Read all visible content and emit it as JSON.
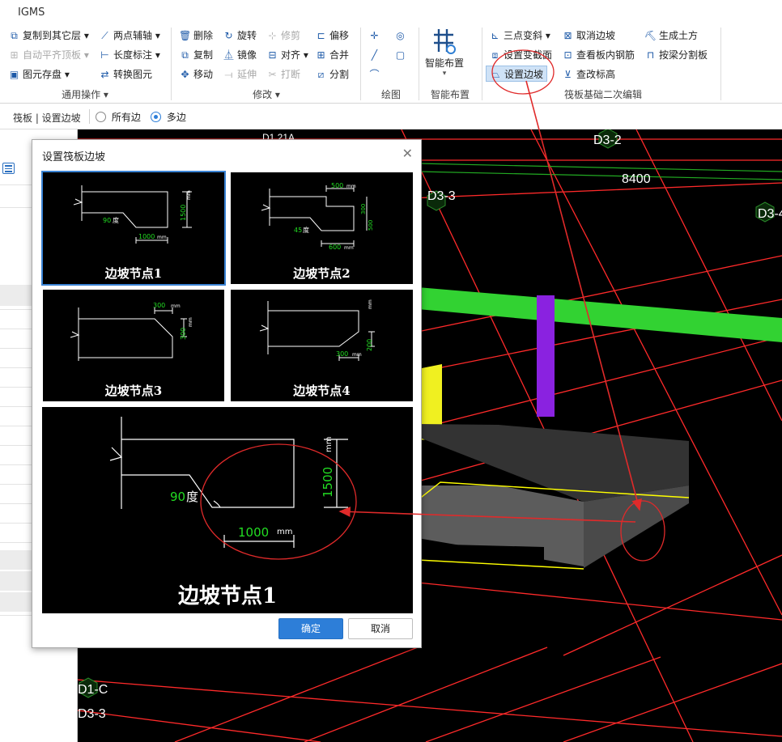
{
  "app": {
    "title": "IGMS"
  },
  "ribbon": {
    "general": {
      "group_label": "通用操作 ▾",
      "copy_to_layer": "复制到其它层 ▾",
      "auto_align": "自动平齐顶板 ▾",
      "save_element": "图元存盘 ▾",
      "two_point_axis": "两点辅轴 ▾",
      "length_dim": "长度标注 ▾",
      "convert_element": "转换图元"
    },
    "modify": {
      "group_label": "修改 ▾",
      "delete": "删除",
      "rotate": "旋转",
      "trim": "修剪",
      "copy": "复制",
      "mirror": "镜像",
      "align": "对齐 ▾",
      "move": "移动",
      "extend": "延伸",
      "break": "打断",
      "offset": "偏移",
      "merge": "合并",
      "split": "分割"
    },
    "draw": {
      "group_label": "绘图"
    },
    "smart": {
      "label": "智能布置",
      "arrow": "▾",
      "group_label": "智能布置"
    },
    "raft": {
      "group_label": "筏板基础二次编辑",
      "three_point_slope": "三点变斜 ▾",
      "set_variable_section": "设置变截面",
      "set_edge_slope": "设置边坡",
      "cancel_edge_slope": "取消边坡",
      "view_rebar": "查看板内钢筋",
      "check_elevation": "查改标高",
      "generate_earthwork": "生成土方",
      "split_by_beam": "按梁分割板"
    }
  },
  "option_bar": {
    "breadcrumb": "筏板 | 设置边坡",
    "radio_all": "所有边",
    "radio_multi": "多边",
    "selected": "多边"
  },
  "viewport": {
    "labels": [
      "D3-2",
      "8400",
      "D3-3",
      "D3-4",
      "D1-C",
      "D3-3",
      "D1 21A"
    ],
    "colors": {
      "grid": "#ff2a2a",
      "slab": "#3a3a3a",
      "beam": "#32d232",
      "column": "#8a22e0",
      "wall": "#f0f020",
      "edge": "#ffff00"
    }
  },
  "dialog": {
    "title": "设置筏板边坡",
    "close": "✕",
    "options": [
      {
        "caption": "边坡节点1",
        "angle": "90",
        "angle_unit": "度",
        "width": "1000",
        "width_unit": "mm",
        "height": "1500",
        "height_unit": "mm"
      },
      {
        "caption": "边坡节点2",
        "top_width": "500",
        "top_unit": "mm",
        "height_upper": "300",
        "height_lower": "500",
        "angle": "45",
        "angle_unit": "度",
        "bottom_width": "600",
        "bottom_unit": "mm"
      },
      {
        "caption": "边坡节点3",
        "width": "300",
        "width_unit": "mm",
        "height": "300",
        "height_unit": "mm"
      },
      {
        "caption": "边坡节点4",
        "width": "300",
        "width_unit": "mm",
        "height": "200",
        "height_unit": "mm"
      }
    ],
    "selected_index": 0,
    "preview": {
      "caption": "边坡节点1",
      "angle": "90",
      "angle_unit": "度",
      "width": "1000",
      "width_unit": "mm",
      "height": "1500",
      "height_unit": "mm"
    },
    "ok_label": "确定",
    "cancel_label": "取消",
    "accent": "#2d7ed8",
    "dimension_color": "#22dd22"
  },
  "annotation_color": "#e02a2a"
}
